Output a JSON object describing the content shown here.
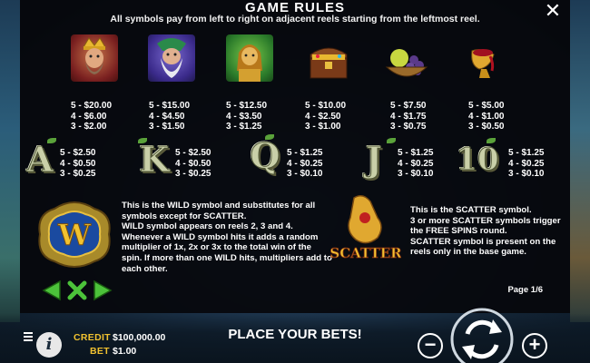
{
  "paytable": {
    "title": "GAME RULES",
    "subtitle": "All symbols pay from left to right on adjacent reels starting from the leftmost reel.",
    "close_icon": "close-icon",
    "high_symbols": [
      {
        "name": "king",
        "pays": "5 - $20.00\n4 - $6.00\n3 - $2.00"
      },
      {
        "name": "wizard",
        "pays": "5 - $15.00\n4 - $4.50\n3 - $1.50"
      },
      {
        "name": "queen",
        "pays": "5 - $12.50\n4 - $3.50\n3 - $1.25"
      },
      {
        "name": "treasure-chest",
        "pays": "5 - $10.00\n4 - $2.50\n3 - $1.00"
      },
      {
        "name": "fruit-bowl",
        "pays": "5 - $7.50\n4 - $1.75\n3 - $0.75"
      },
      {
        "name": "goblet",
        "pays": "5 - $5.00\n4 - $1.00\n3 - $0.50"
      }
    ],
    "low_symbols": [
      {
        "letter": "A",
        "pays": "5 - $2.50\n4 - $0.50\n3 - $0.25"
      },
      {
        "letter": "K",
        "pays": "5 - $2.50\n4 - $0.50\n3 - $0.25"
      },
      {
        "letter": "Q",
        "pays": "5 - $1.25\n4 - $0.25\n3 - $0.10"
      },
      {
        "letter": "J",
        "pays": "5 - $1.25\n4 - $0.25\n3 - $0.10"
      },
      {
        "letter": "10",
        "pays": "5 - $1.25\n4 - $0.25\n3 - $0.10"
      }
    ],
    "wild": {
      "icon_letter": "W",
      "p1": "This is the WILD symbol and substitutes for all symbols except for SCATTER.",
      "p2": "WILD symbol appears on reels 2, 3 and 4.",
      "p3": "Whenever a WILD symbol hits it adds a random multiplier of 1x, 2x or 3x to the total win of the spin. If more than one WILD hits, multipliers add to each other."
    },
    "scatter": {
      "icon_label": "SCATTER",
      "p1": "This is the SCATTER symbol.",
      "p2": "3 or more SCATTER symbols trigger the FREE SPINS round.",
      "p3": "SCATTER symbol is present on the reels only in the base game."
    },
    "page": "Page 1/6"
  },
  "bottom_bar": {
    "credit_label": "CREDIT",
    "credit_value": "$100,000.00",
    "bet_label": "BET",
    "bet_value": "$1.00",
    "message": "PLACE YOUR BETS!",
    "info_label": "i",
    "minus_label": "−",
    "plus_label": "+"
  },
  "colors": {
    "accent_gold": "#f2c230",
    "nav_green": "#4cc23a",
    "panel_bg": "#06080c"
  }
}
